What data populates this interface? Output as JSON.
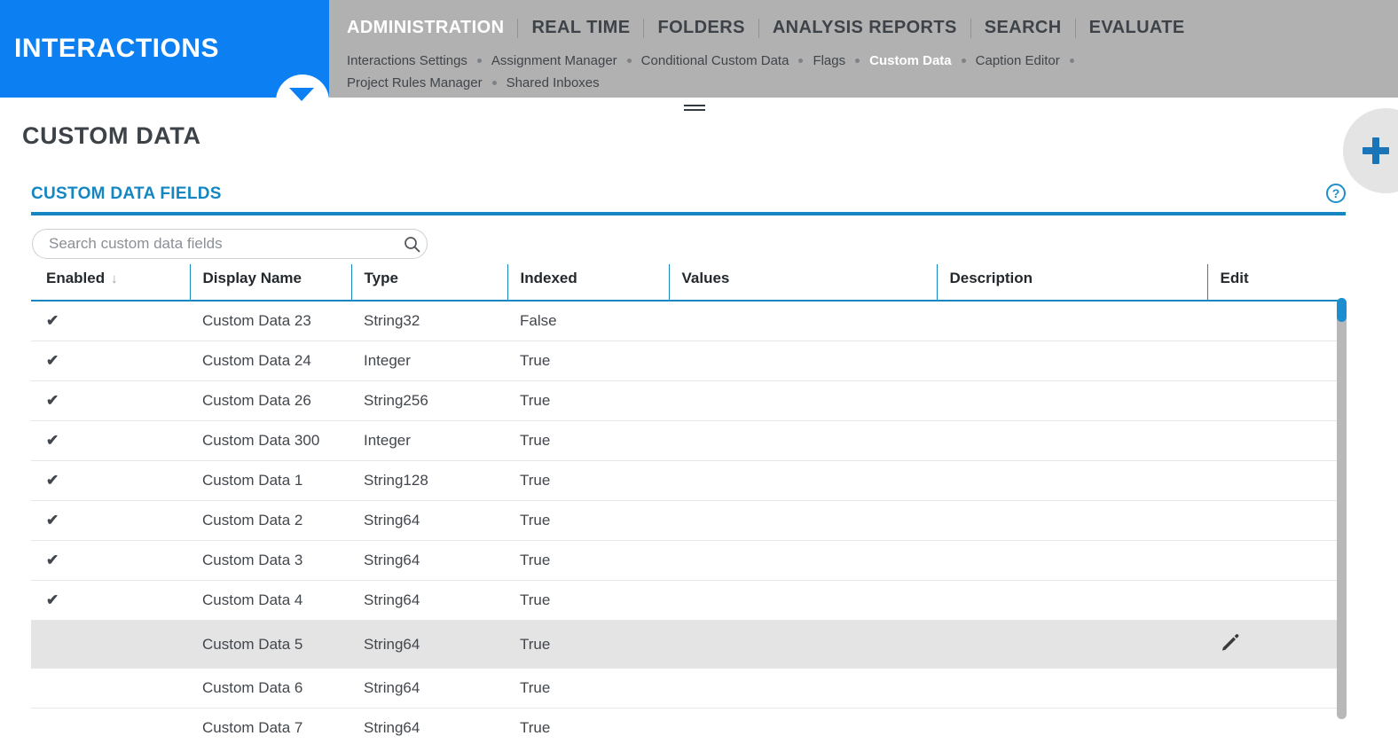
{
  "brand": {
    "name": "INTERACTIONS",
    "color": "#0c80f2",
    "caret_icon": "chevron-down-icon"
  },
  "nav": {
    "main": [
      {
        "label": "ADMINISTRATION",
        "active": true
      },
      {
        "label": "REAL TIME",
        "active": false
      },
      {
        "label": "FOLDERS",
        "active": false
      },
      {
        "label": "ANALYSIS REPORTS",
        "active": false
      },
      {
        "label": "SEARCH",
        "active": false
      },
      {
        "label": "EVALUATE",
        "active": false
      }
    ],
    "sub": [
      {
        "label": "Interactions Settings",
        "active": false
      },
      {
        "label": "Assignment Manager",
        "active": false
      },
      {
        "label": "Conditional Custom Data",
        "active": false
      },
      {
        "label": "Flags",
        "active": false
      },
      {
        "label": "Custom Data",
        "active": true
      },
      {
        "label": "Caption Editor",
        "active": false
      },
      {
        "label": "Project Rules Manager",
        "active": false
      },
      {
        "label": "Shared Inboxes",
        "active": false
      }
    ]
  },
  "page": {
    "title": "CUSTOM DATA",
    "panel_title": "CUSTOM DATA FIELDS",
    "help_glyph": "?",
    "accent_color": "#1487c2"
  },
  "search": {
    "placeholder": "Search custom data fields",
    "value": "",
    "icon": "search-icon"
  },
  "table": {
    "columns": [
      "Enabled",
      "Display Name",
      "Type",
      "Indexed",
      "Values",
      "Description",
      "Edit"
    ],
    "sort": {
      "column": "Enabled",
      "direction": "down",
      "glyph": "↓"
    },
    "check_glyph": "✔",
    "rows": [
      {
        "enabled": "✔",
        "name": "Custom Data 23",
        "type": "String32",
        "indexed": "False",
        "values": "",
        "description": "",
        "edit": "",
        "highlighted": false
      },
      {
        "enabled": "✔",
        "name": "Custom Data 24",
        "type": "Integer",
        "indexed": "True",
        "values": "",
        "description": "",
        "edit": "",
        "highlighted": false
      },
      {
        "enabled": "✔",
        "name": "Custom Data 26",
        "type": "String256",
        "indexed": "True",
        "values": "",
        "description": "",
        "edit": "",
        "highlighted": false
      },
      {
        "enabled": "✔",
        "name": "Custom Data 300",
        "type": "Integer",
        "indexed": "True",
        "values": "",
        "description": "",
        "edit": "",
        "highlighted": false
      },
      {
        "enabled": "✔",
        "name": "Custom Data 1",
        "type": "String128",
        "indexed": "True",
        "values": "",
        "description": "",
        "edit": "",
        "highlighted": false
      },
      {
        "enabled": "✔",
        "name": "Custom Data 2",
        "type": "String64",
        "indexed": "True",
        "values": "",
        "description": "",
        "edit": "",
        "highlighted": false
      },
      {
        "enabled": "✔",
        "name": "Custom Data 3",
        "type": "String64",
        "indexed": "True",
        "values": "",
        "description": "",
        "edit": "",
        "highlighted": false
      },
      {
        "enabled": "✔",
        "name": "Custom Data 4",
        "type": "String64",
        "indexed": "True",
        "values": "",
        "description": "",
        "edit": "",
        "highlighted": false
      },
      {
        "enabled": "",
        "name": "Custom Data 5",
        "type": "String64",
        "indexed": "True",
        "values": "",
        "description": "",
        "edit": "edit-pencil-icon",
        "highlighted": true
      },
      {
        "enabled": "",
        "name": "Custom Data 6",
        "type": "String64",
        "indexed": "True",
        "values": "",
        "description": "",
        "edit": "",
        "highlighted": false
      },
      {
        "enabled": "",
        "name": "Custom Data 7",
        "type": "String64",
        "indexed": "True",
        "values": "",
        "description": "",
        "edit": "",
        "highlighted": false
      }
    ]
  },
  "fab": {
    "icon": "plus-icon",
    "color": "#1a74b8"
  },
  "scrollbar": {
    "orientation": "vertical",
    "thumb_position": "top"
  }
}
